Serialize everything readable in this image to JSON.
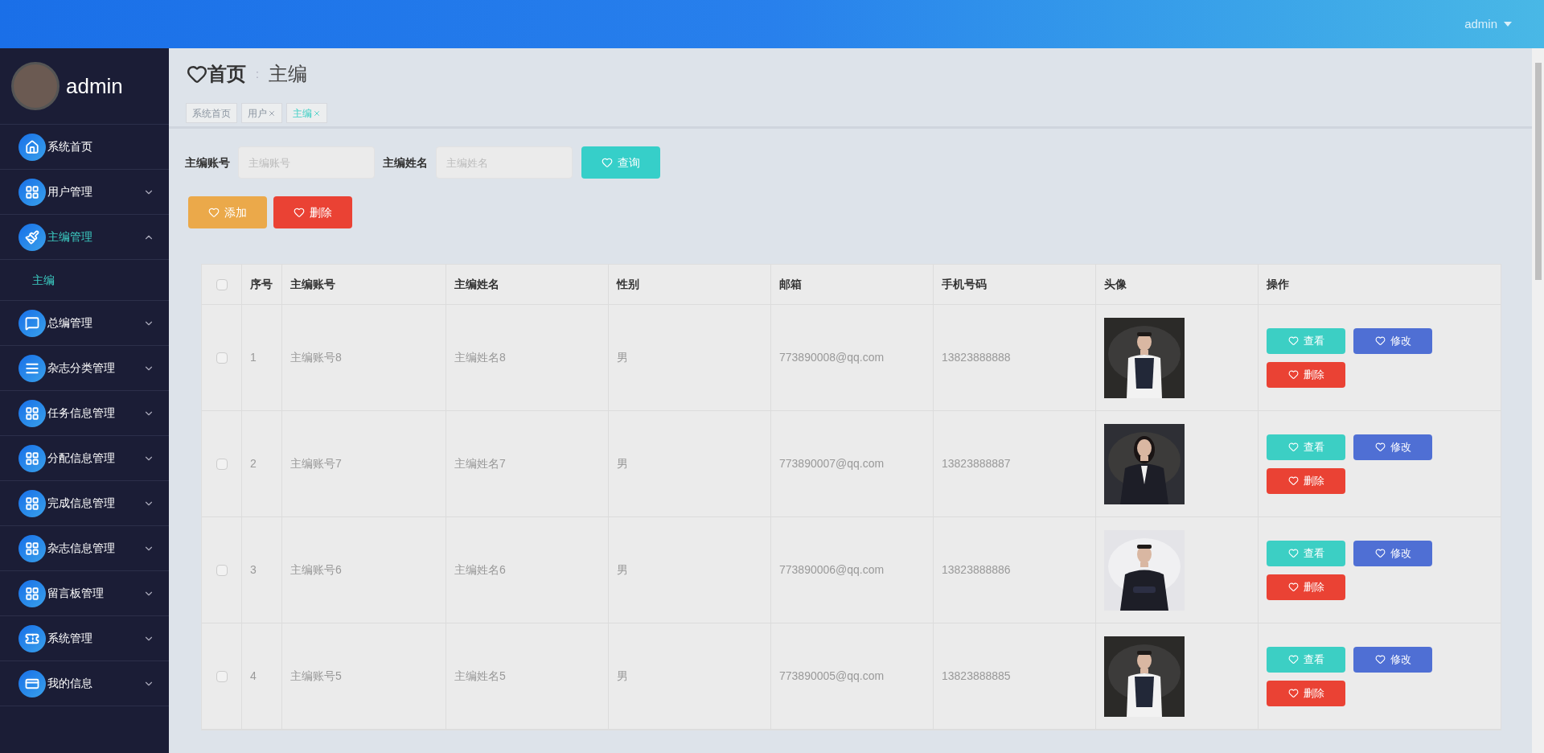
{
  "topbar": {
    "user": "admin"
  },
  "sidebar": {
    "user": "admin",
    "menu": [
      {
        "kind": "link",
        "label": "系统首页",
        "selected": false
      },
      {
        "kind": "menu",
        "label": "用户管理",
        "selected": false,
        "expanded": false
      },
      {
        "kind": "menu",
        "label": "主编管理",
        "selected": true,
        "expanded": true,
        "children": [
          {
            "label": "主编",
            "selected": true
          }
        ]
      },
      {
        "kind": "menu",
        "label": "总编管理",
        "selected": false,
        "expanded": false
      },
      {
        "kind": "menu",
        "label": "杂志分类管理",
        "selected": false,
        "expanded": false
      },
      {
        "kind": "menu",
        "label": "任务信息管理",
        "selected": false,
        "expanded": false
      },
      {
        "kind": "menu",
        "label": "分配信息管理",
        "selected": false,
        "expanded": false
      },
      {
        "kind": "menu",
        "label": "完成信息管理",
        "selected": false,
        "expanded": false
      },
      {
        "kind": "menu",
        "label": "杂志信息管理",
        "selected": false,
        "expanded": false
      },
      {
        "kind": "menu",
        "label": "留言板管理",
        "selected": false,
        "expanded": false
      },
      {
        "kind": "menu",
        "label": "系统管理",
        "selected": false,
        "expanded": false
      },
      {
        "kind": "menu",
        "label": "我的信息",
        "selected": false,
        "expanded": false
      }
    ]
  },
  "page_title": {
    "home": "首页",
    "separator": ":",
    "current": "主编"
  },
  "tabs": [
    {
      "label": "系统首页",
      "closable": false,
      "selected": false
    },
    {
      "label": "用户",
      "closable": true,
      "selected": false
    },
    {
      "label": "主编",
      "closable": true,
      "selected": true
    }
  ],
  "search": {
    "fields": [
      {
        "label": "主编账号",
        "placeholder": "主编账号"
      },
      {
        "label": "主编姓名",
        "placeholder": "主编姓名"
      }
    ],
    "button": "查询"
  },
  "actions": [
    {
      "label": "添加",
      "kind": "add"
    },
    {
      "label": "删除",
      "kind": "delete"
    }
  ],
  "table": {
    "columns": [
      "序号",
      "主编账号",
      "主编姓名",
      "性别",
      "邮箱",
      "手机号码",
      "头像",
      "操作"
    ],
    "header_checked": false,
    "rows": [
      {
        "checked": false,
        "cells": [
          "1",
          "主编账号8",
          "主编姓名8",
          "男",
          "773890008@qq.com",
          "13823888888"
        ],
        "photo": {
          "kind": "picture"
        },
        "actions": [
          {
            "label": "查看",
            "kind": "view"
          },
          {
            "label": "修改",
            "kind": "edit"
          },
          {
            "label": "删除",
            "kind": "delete"
          }
        ]
      },
      {
        "checked": false,
        "cells": [
          "2",
          "主编账号7",
          "主编姓名7",
          "男",
          "773890007@qq.com",
          "13823888887"
        ],
        "photo": {
          "kind": "picture"
        },
        "actions": [
          {
            "label": "查看",
            "kind": "view"
          },
          {
            "label": "修改",
            "kind": "edit"
          },
          {
            "label": "删除",
            "kind": "delete"
          }
        ]
      },
      {
        "checked": false,
        "cells": [
          "3",
          "主编账号6",
          "主编姓名6",
          "男",
          "773890006@qq.com",
          "13823888886"
        ],
        "photo": {
          "kind": "picture"
        },
        "actions": [
          {
            "label": "查看",
            "kind": "view"
          },
          {
            "label": "修改",
            "kind": "edit"
          },
          {
            "label": "删除",
            "kind": "delete"
          }
        ]
      },
      {
        "checked": false,
        "cells": [
          "4",
          "主编账号5",
          "主编姓名5",
          "男",
          "773890005@qq.com",
          "13823888885"
        ],
        "photo": {
          "kind": "picture"
        },
        "actions": [
          {
            "label": "查看",
            "kind": "view"
          },
          {
            "label": "修改",
            "kind": "edit"
          },
          {
            "label": "删除",
            "kind": "delete"
          }
        ]
      }
    ]
  }
}
